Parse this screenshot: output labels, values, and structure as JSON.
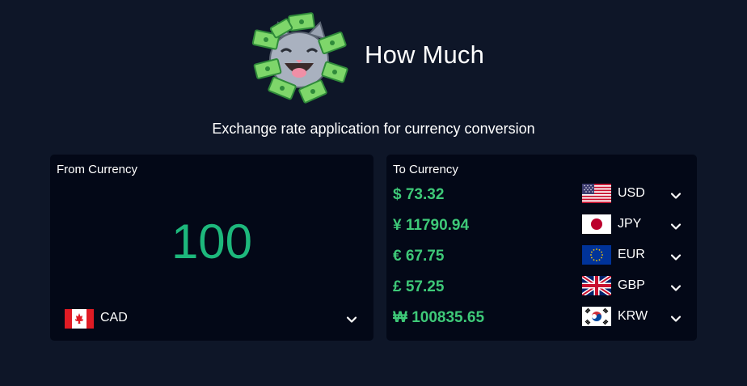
{
  "header": {
    "title": "How Much",
    "subtitle": "Exchange rate application for currency conversion"
  },
  "from": {
    "label": "From Currency",
    "amount": "100",
    "currency": {
      "code": "CAD",
      "flag_icon": "canada-flag-icon"
    }
  },
  "to": {
    "label": "To Currency",
    "rows": [
      {
        "value": "$ 73.32",
        "code": "USD",
        "flag_icon": "usa-flag-icon"
      },
      {
        "value": "¥ 11790.94",
        "code": "JPY",
        "flag_icon": "japan-flag-icon"
      },
      {
        "value": "€ 67.75",
        "code": "EUR",
        "flag_icon": "eu-flag-icon"
      },
      {
        "value": "£ 57.25",
        "code": "GBP",
        "flag_icon": "uk-flag-icon"
      },
      {
        "value": "₩ 100835.65",
        "code": "KRW",
        "flag_icon": "korea-flag-icon"
      }
    ]
  },
  "colors": {
    "background": "#0e1628",
    "panel": "#030817",
    "amount": "#1db87c",
    "converted": "#3ec978"
  }
}
